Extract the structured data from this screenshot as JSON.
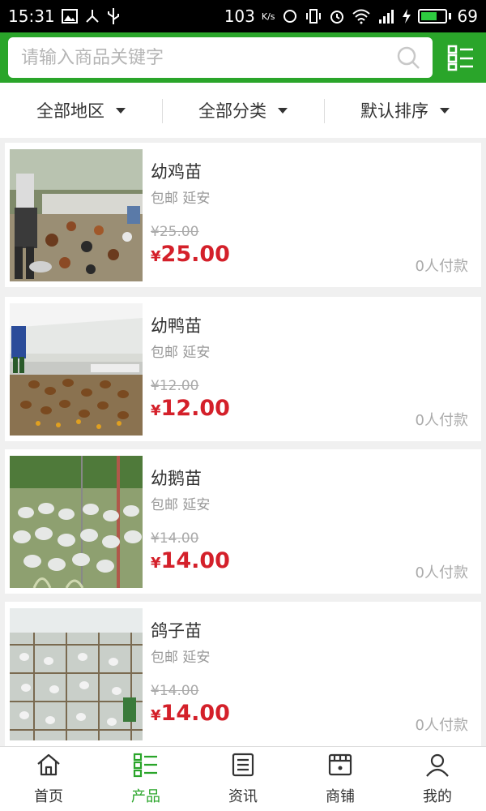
{
  "status_bar": {
    "time": "15:31",
    "network_speed": "103",
    "network_unit": "K/s",
    "battery_level": "69",
    "battery_fraction": 0.69
  },
  "search": {
    "placeholder": "请输入商品关键字"
  },
  "filters": [
    {
      "label": "全部地区"
    },
    {
      "label": "全部分类"
    },
    {
      "label": "默认排序"
    }
  ],
  "products": [
    {
      "name": "幼鸡苗",
      "tags": "包邮 延安",
      "original_price": "¥25.00",
      "currency": "¥",
      "price": "25.00",
      "sold": "0人付款"
    },
    {
      "name": "幼鸭苗",
      "tags": "包邮 延安",
      "original_price": "¥12.00",
      "currency": "¥",
      "price": "12.00",
      "sold": "0人付款"
    },
    {
      "name": "幼鹅苗",
      "tags": "包邮 延安",
      "original_price": "¥14.00",
      "currency": "¥",
      "price": "14.00",
      "sold": "0人付款"
    },
    {
      "name": "鸽子苗",
      "tags": "包邮 延安",
      "original_price": "¥14.00",
      "currency": "¥",
      "price": "14.00",
      "sold": "0人付款"
    }
  ],
  "tabs": [
    {
      "label": "首页",
      "icon": "home-icon"
    },
    {
      "label": "产品",
      "icon": "list-icon"
    },
    {
      "label": "资讯",
      "icon": "news-icon"
    },
    {
      "label": "商铺",
      "icon": "shop-icon"
    },
    {
      "label": "我的",
      "icon": "user-icon"
    }
  ],
  "colors": {
    "brand_green": "#2aa52a",
    "price_red": "#d4202a"
  }
}
